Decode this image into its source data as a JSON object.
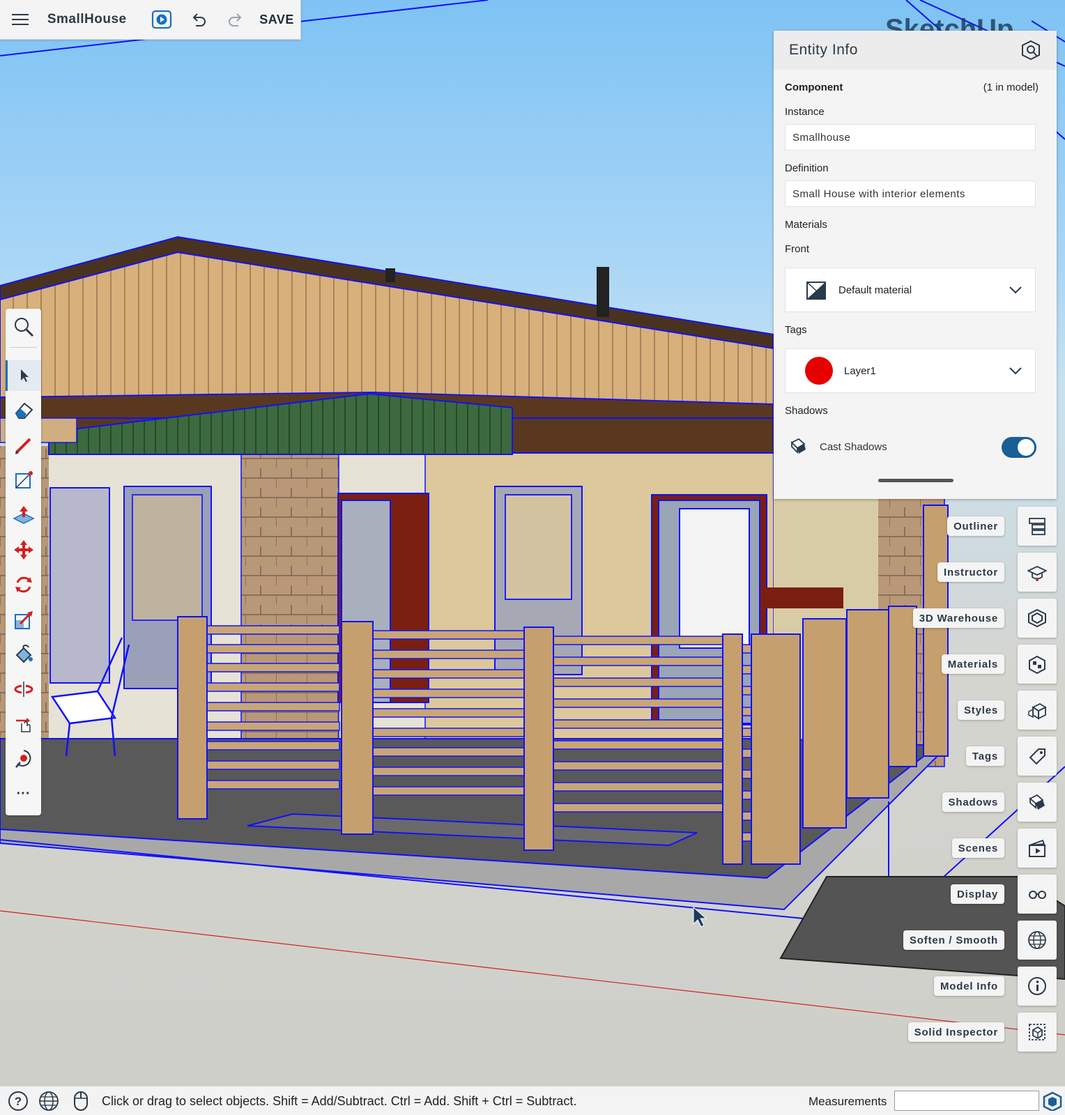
{
  "app": {
    "file_name": "SmallHouse",
    "save_label": "SAVE",
    "brand_watermark": "SketchUp"
  },
  "toolbar": {
    "tools": [
      "search-icon",
      "select-icon",
      "eraser-icon",
      "pencil-icon",
      "rectangle-icon",
      "push-pull-icon",
      "move-icon",
      "rotate-icon",
      "scale-icon",
      "paint-bucket-icon",
      "orbit-icon",
      "pan-icon",
      "tape-measure-icon",
      "more-icon"
    ],
    "more_label": "···",
    "active_tool": "select-icon"
  },
  "entity_info": {
    "title": "Entity Info",
    "component_label": "Component",
    "component_count": "(1 in model)",
    "instance_label": "Instance",
    "instance_value": "Smallhouse",
    "definition_label": "Definition",
    "definition_value": "Small House with interior elements",
    "materials_label": "Materials",
    "front_label": "Front",
    "front_material": "Default material",
    "tags_label": "Tags",
    "tag_value": "Layer1",
    "tag_color": "#e60000",
    "shadows_label": "Shadows",
    "cast_shadows_label": "Cast Shadows",
    "cast_shadows_on": true
  },
  "panels": [
    {
      "label": "Outliner",
      "icon": "outliner-icon"
    },
    {
      "label": "Instructor",
      "icon": "instructor-icon"
    },
    {
      "label": "3D Warehouse",
      "icon": "warehouse-icon"
    },
    {
      "label": "Materials",
      "icon": "materials-icon"
    },
    {
      "label": "Styles",
      "icon": "styles-icon"
    },
    {
      "label": "Tags",
      "icon": "tags-icon"
    },
    {
      "label": "Shadows",
      "icon": "shadows-icon"
    },
    {
      "label": "Scenes",
      "icon": "scenes-icon"
    },
    {
      "label": "Display",
      "icon": "display-icon"
    },
    {
      "label": "Soften / Smooth",
      "icon": "soften-icon"
    },
    {
      "label": "Model Info",
      "icon": "model-info-icon"
    },
    {
      "label": "Solid Inspector",
      "icon": "solid-inspector-icon"
    }
  ],
  "statusbar": {
    "message": "Click or drag to select objects. Shift = Add/Subtract. Ctrl = Add. Shift + Ctrl = Subtract.",
    "measurements_label": "Measurements",
    "measurements_value": ""
  },
  "colors": {
    "accent": "#1a5e96",
    "selection": "#1010ff",
    "axis_red": "#d42020"
  }
}
